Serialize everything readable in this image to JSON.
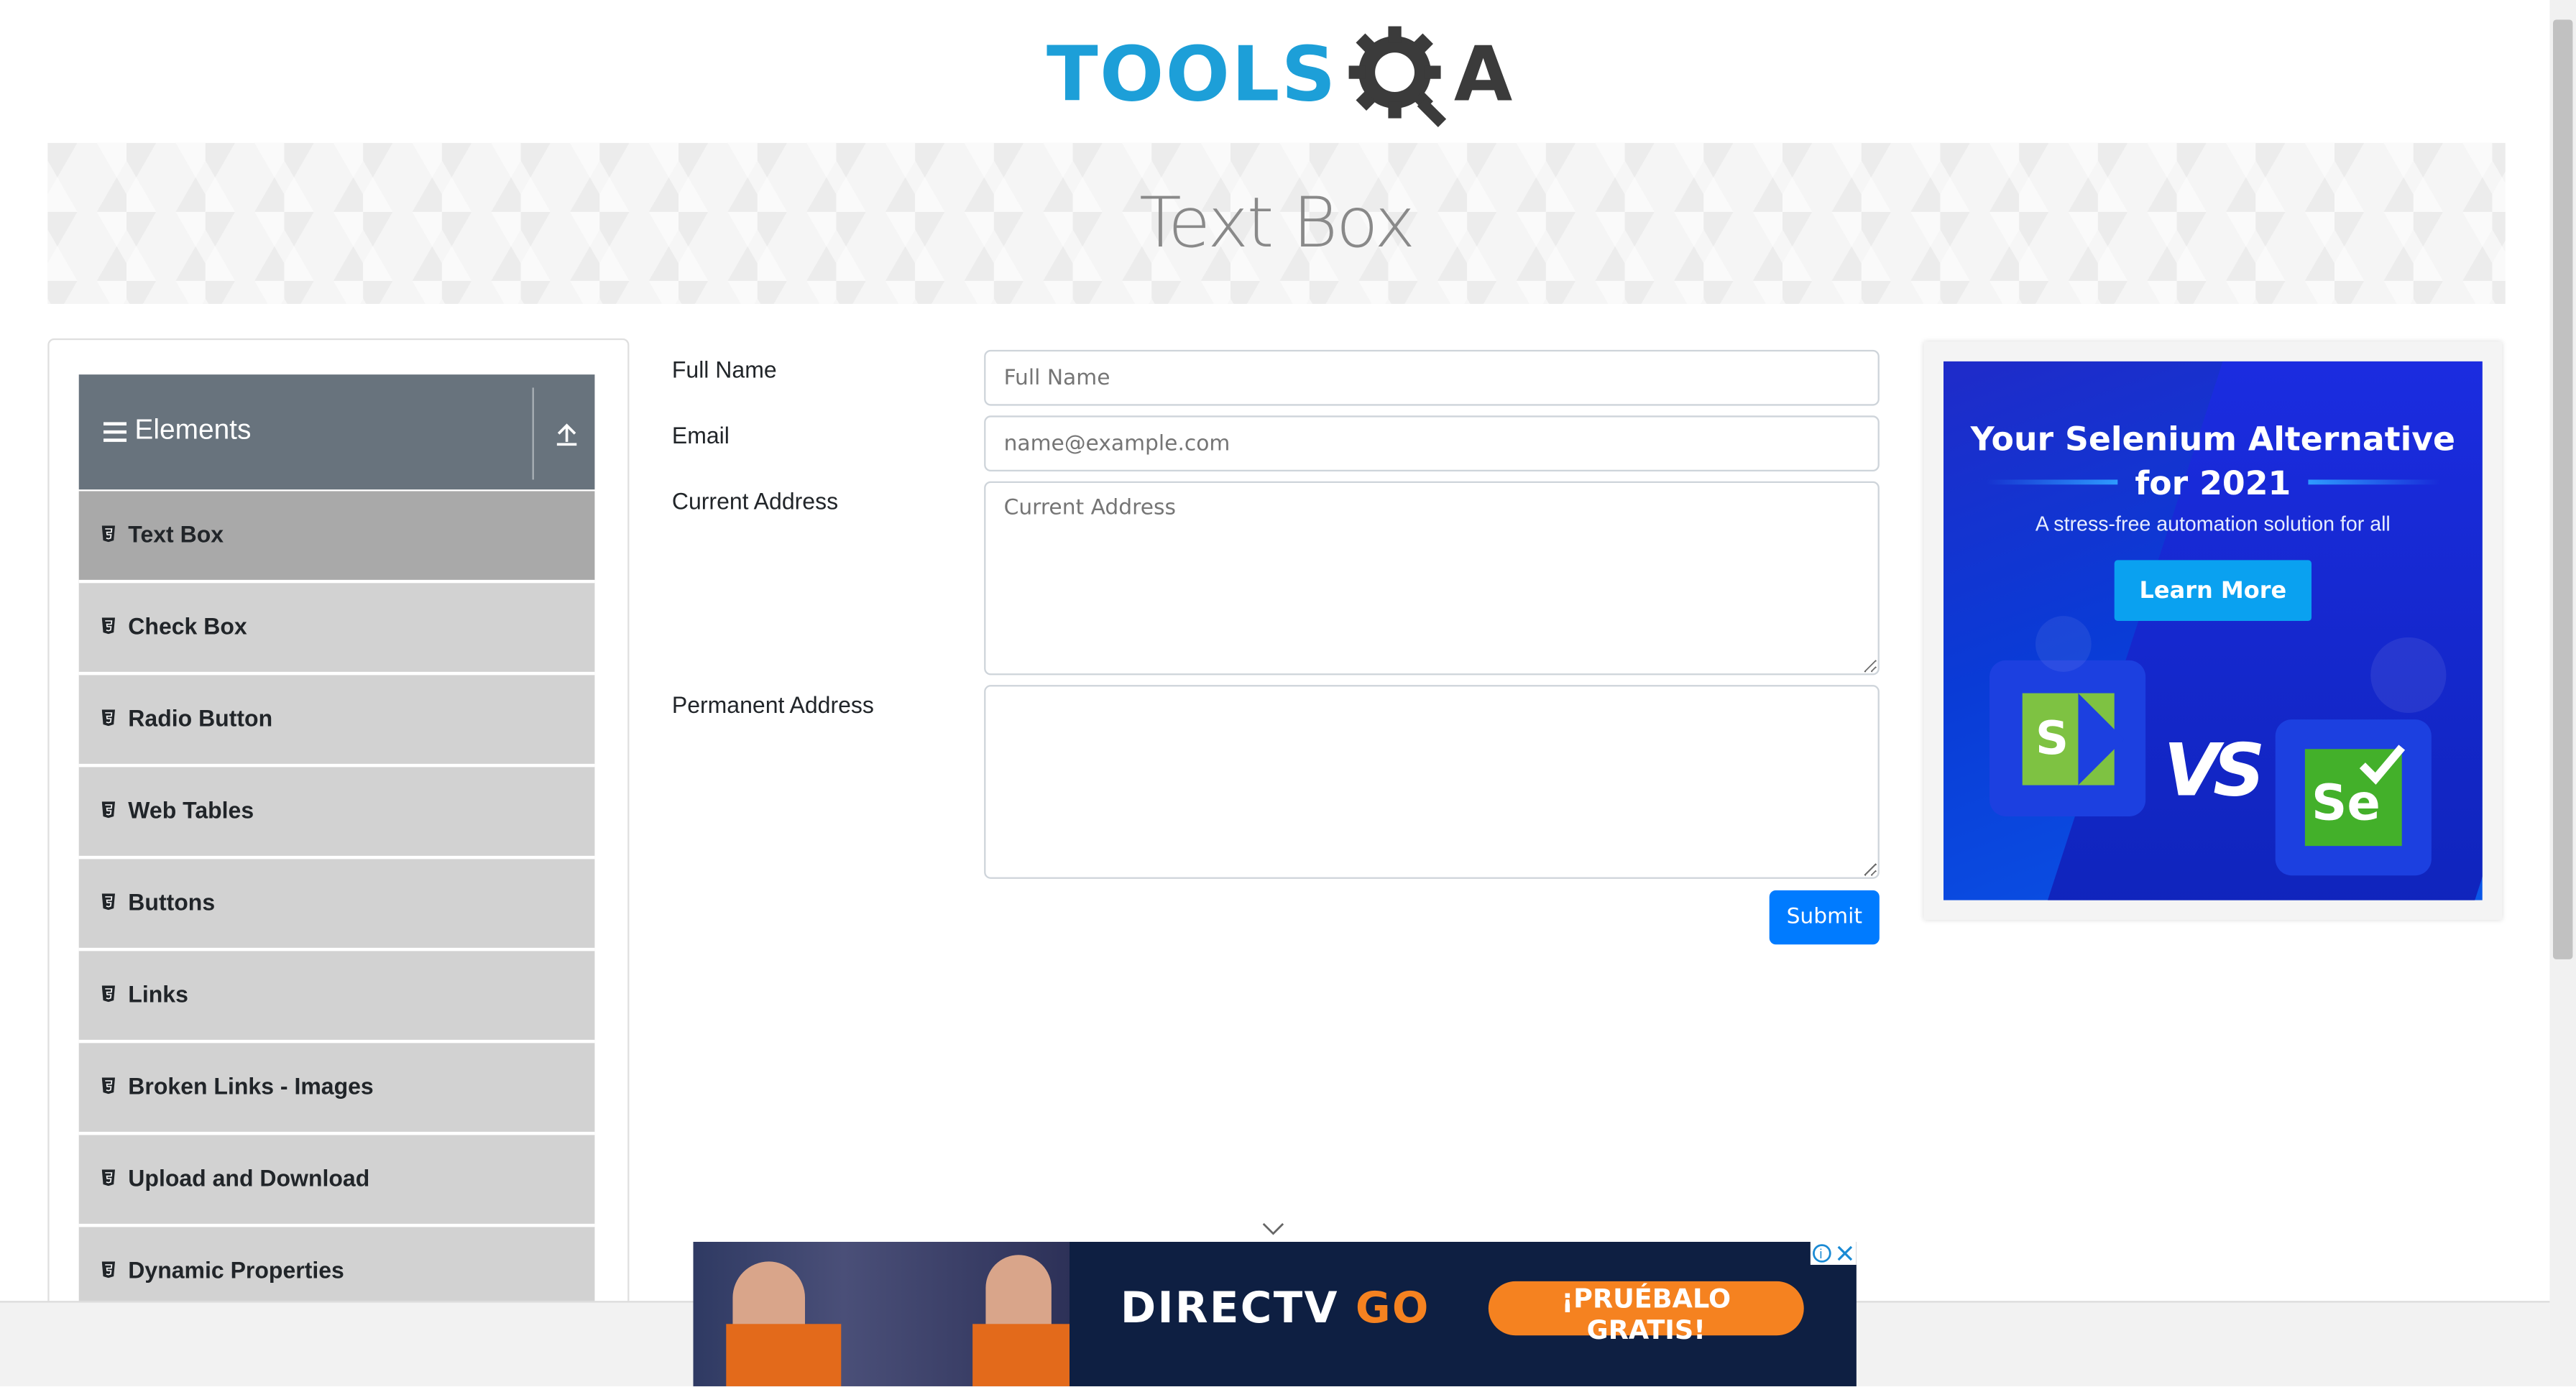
{
  "logo": {
    "text_blue": "TOOLS",
    "text_dark": "A"
  },
  "page_title": "Text Box",
  "sidebar": {
    "group_title": "Elements",
    "items": [
      {
        "label": "Text Box",
        "active": true
      },
      {
        "label": "Check Box"
      },
      {
        "label": "Radio Button"
      },
      {
        "label": "Web Tables"
      },
      {
        "label": "Buttons"
      },
      {
        "label": "Links"
      },
      {
        "label": "Broken Links - Images"
      },
      {
        "label": "Upload and Download"
      },
      {
        "label": "Dynamic Properties"
      }
    ]
  },
  "form": {
    "full_name": {
      "label": "Full Name",
      "placeholder": "Full Name",
      "value": ""
    },
    "email": {
      "label": "Email",
      "placeholder": "name@example.com",
      "value": ""
    },
    "current_address": {
      "label": "Current Address",
      "placeholder": "Current Address",
      "value": ""
    },
    "permanent_address": {
      "label": "Permanent Address",
      "placeholder": "",
      "value": ""
    },
    "submit_label": "Submit"
  },
  "right_ad": {
    "title_line1": "Your Selenium Alternative",
    "title_line2": "for 2021",
    "subtitle": "A stress-free automation solution for all",
    "cta": "Learn More",
    "vs": "VS",
    "logo_left": "S",
    "logo_right": "Se"
  },
  "bottom_ad": {
    "brand_main": "DIRECTV",
    "brand_go": "GO",
    "cta": "¡PRUÉBALO GRATIS!"
  },
  "colors": {
    "accent": "#007bff",
    "sidebar_header": "#68737d",
    "menu_item": "#d2d2d2",
    "menu_item_active": "#a9a9a9",
    "logo_blue": "#1d9fd8"
  }
}
